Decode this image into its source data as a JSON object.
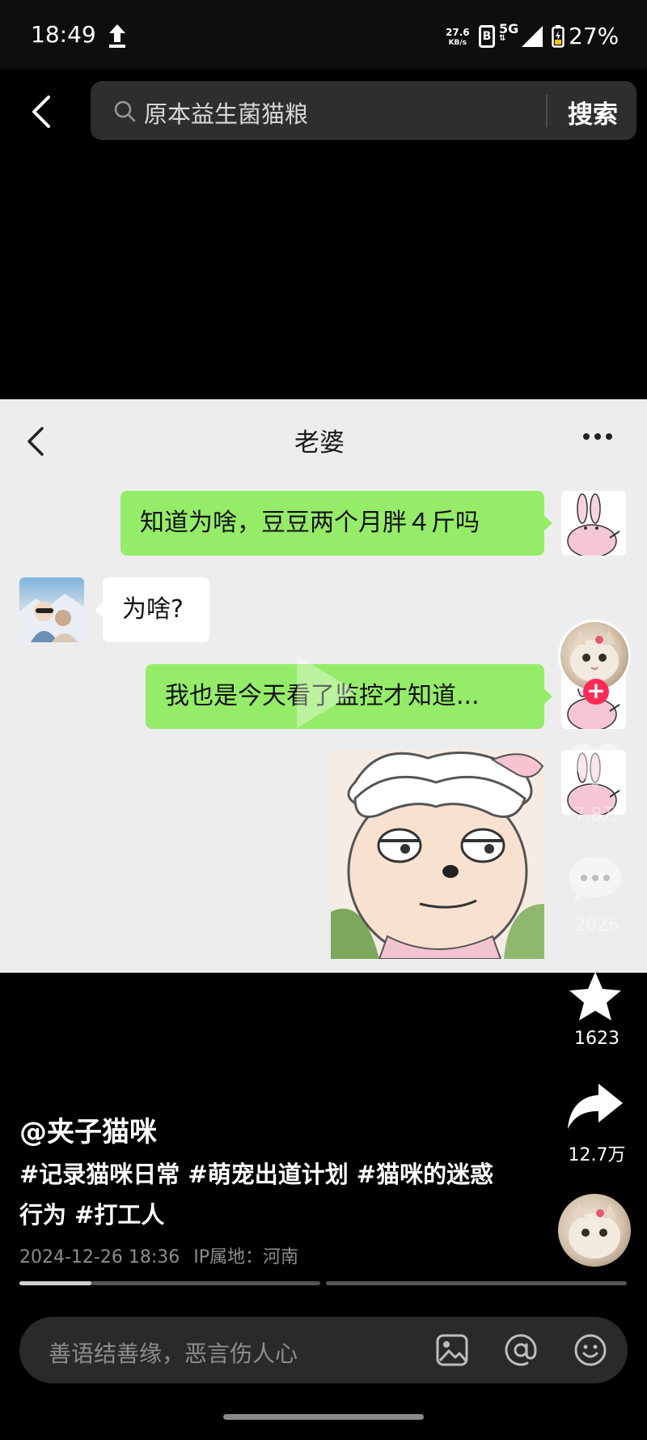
{
  "status_bar": {
    "time": "18:49",
    "net_speed": "27.6",
    "net_unit": "KB/s",
    "sim": "B",
    "network": "5G",
    "battery": "27%"
  },
  "search": {
    "query": "原本益生菌猫粮",
    "button": "搜索"
  },
  "chat": {
    "title": "老婆",
    "messages": [
      {
        "side": "right",
        "text": "知道为啥，豆豆两个月胖４斤吗"
      },
      {
        "side": "left",
        "text": "为啥?"
      },
      {
        "side": "right",
        "text": "我也是今天看了监控才知道..."
      }
    ]
  },
  "actions": {
    "likes": "7.8万",
    "comments": "2026",
    "favorites": "1623",
    "shares": "12.7万"
  },
  "post": {
    "author": "@夹子猫咪",
    "description": "#记录猫咪日常 #萌宠出道计划 #猫咪的迷惑行为 #打工人",
    "datetime": "2024-12-26 18:36",
    "ip_location": "IP属地：河南",
    "progress": 0.24
  },
  "comment_bar": {
    "placeholder": "善语结善缘，恶言伤人心"
  },
  "colors": {
    "bubble_green": "#95ec69",
    "follow_red": "#fe2c55"
  },
  "icons": [
    "back-icon",
    "search-icon",
    "upload-icon",
    "signal-icon",
    "battery-icon",
    "more-icon",
    "play-icon",
    "heart-icon",
    "comment-icon",
    "star-icon",
    "share-icon",
    "image-icon",
    "at-icon",
    "emoji-icon"
  ]
}
